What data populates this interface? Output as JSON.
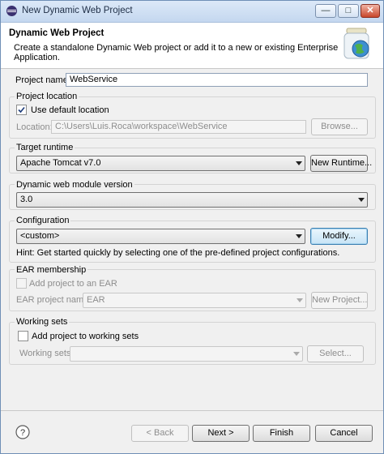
{
  "window": {
    "title": "New Dynamic Web Project",
    "controls": {
      "minimize": "—",
      "maximize": "□",
      "close": "✕"
    }
  },
  "header": {
    "title": "Dynamic Web Project",
    "description": "Create a standalone Dynamic Web project or add it to a new or existing Enterprise Application."
  },
  "project_name": {
    "label": "Project name:",
    "value": "WebService"
  },
  "project_location": {
    "legend": "Project location",
    "use_default_label": "Use default location",
    "use_default_checked": true,
    "location_label": "Location:",
    "location_value": "C:\\Users\\Luis.Roca\\workspace\\WebService",
    "browse_label": "Browse..."
  },
  "target_runtime": {
    "legend": "Target runtime",
    "selected": "Apache Tomcat v7.0",
    "new_runtime_label": "New Runtime..."
  },
  "module_version": {
    "legend": "Dynamic web module version",
    "selected": "3.0"
  },
  "configuration": {
    "legend": "Configuration",
    "selected": "<custom>",
    "modify_label": "Modify...",
    "hint": "Hint: Get started quickly by selecting one of the pre-defined project configurations."
  },
  "ear": {
    "legend": "EAR membership",
    "add_label": "Add project to an EAR",
    "add_checked": false,
    "project_name_label": "EAR project name:",
    "project_name_value": "EAR",
    "new_project_label": "New Project..."
  },
  "working_sets": {
    "legend": "Working sets",
    "add_label": "Add project to working sets",
    "add_checked": false,
    "sets_label": "Working sets:",
    "sets_value": "",
    "select_label": "Select..."
  },
  "footer": {
    "help": "?",
    "back": "< Back",
    "next": "Next >",
    "finish": "Finish",
    "cancel": "Cancel"
  }
}
